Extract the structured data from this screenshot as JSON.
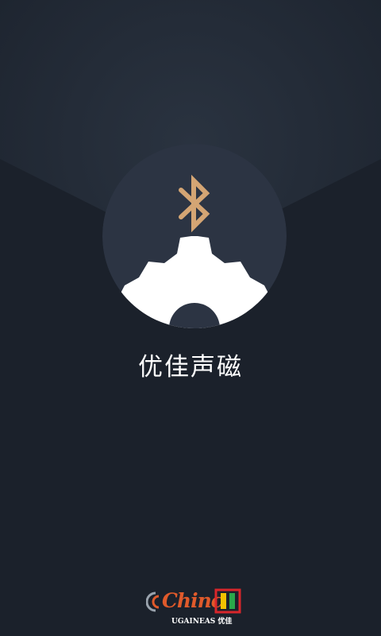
{
  "app": {
    "name": "优佳声磁"
  },
  "icons": {
    "center_logo": "bluetooth-icon",
    "gear": "gear-icon",
    "brand_waves": "signal-waves-icon",
    "brand_mark": "door-frame-icon"
  },
  "brand": {
    "wordmark": "Chinc",
    "tagline": "UGAINEAS 优佳"
  },
  "colors": {
    "background": "#1b212b",
    "circle": "#2c3443",
    "bluetooth": "#d4a574",
    "gear": "#ffffff",
    "text": "#ffffff",
    "brand_orange": "#e05a2b"
  }
}
